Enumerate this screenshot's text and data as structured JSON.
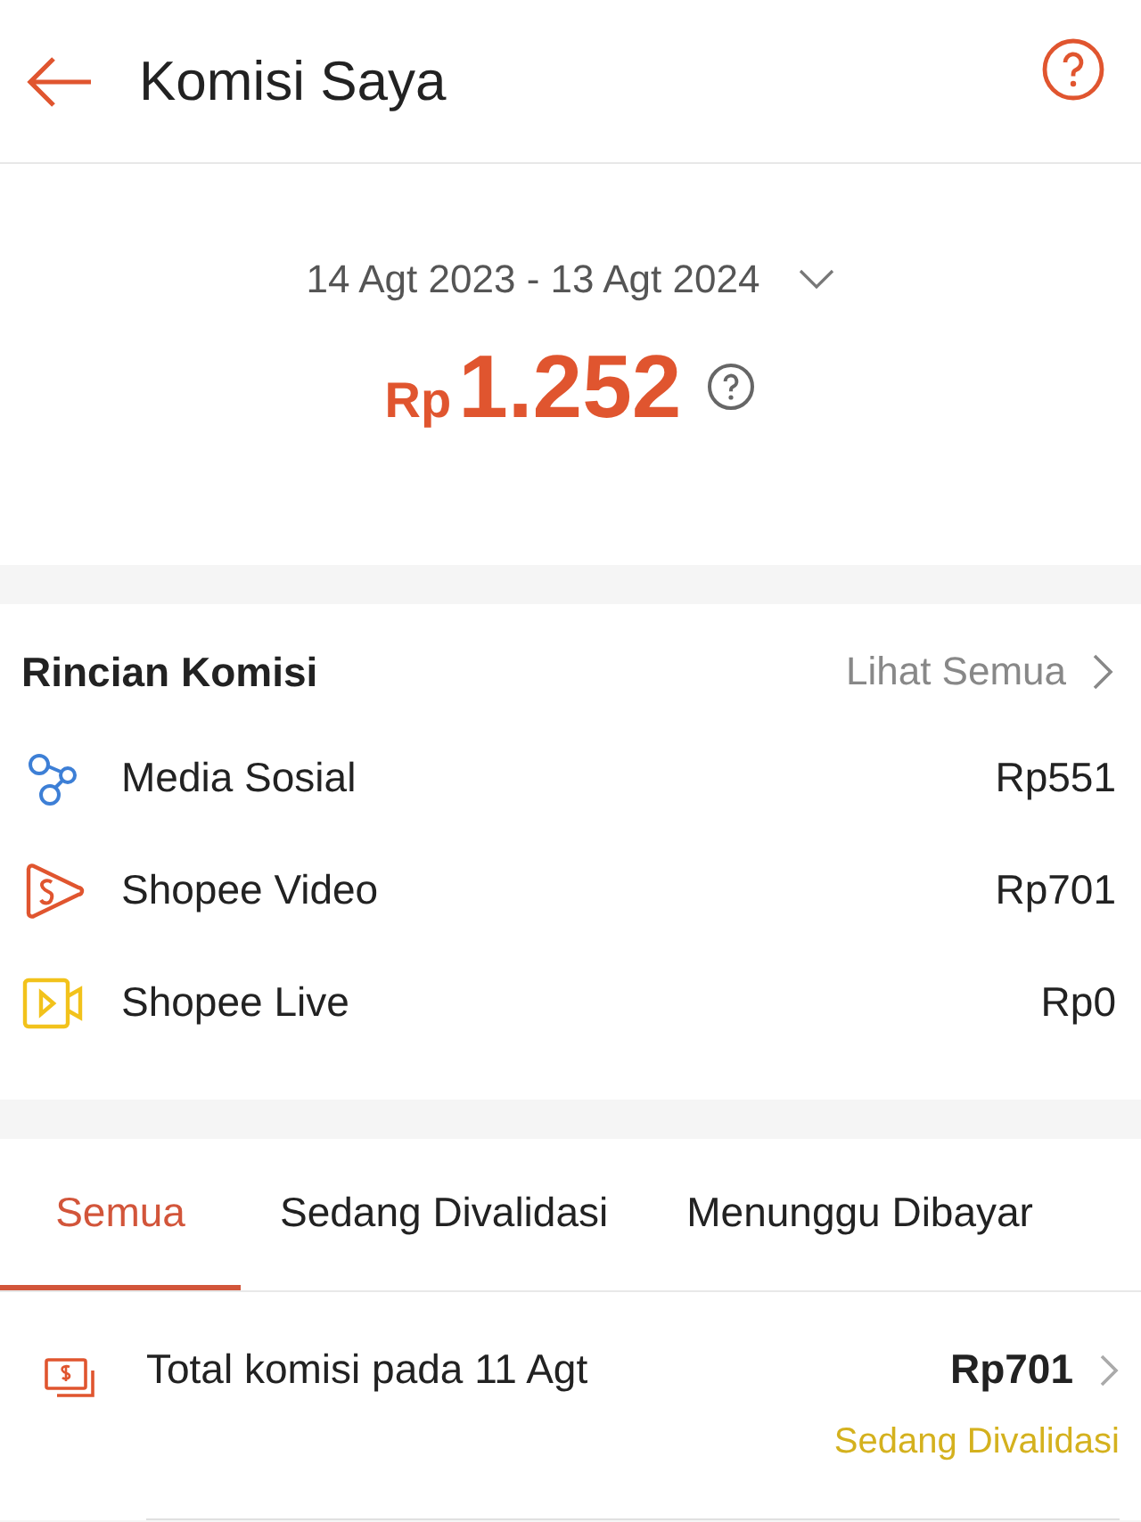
{
  "header": {
    "title": "Komisi Saya"
  },
  "summary": {
    "period": "14 Agt 2023 - 13 Agt 2024",
    "currency": "Rp",
    "amount": "1.252"
  },
  "breakdown": {
    "title": "Rincian Komisi",
    "link": "Lihat Semua",
    "items": [
      {
        "kind": "social",
        "label": "Media Sosial",
        "value": "Rp551"
      },
      {
        "kind": "video",
        "label": "Shopee Video",
        "value": "Rp701"
      },
      {
        "kind": "live",
        "label": "Shopee Live",
        "value": "Rp0"
      }
    ]
  },
  "tabs": [
    {
      "label": "Semua",
      "selected": true
    },
    {
      "label": "Sedang Divalidasi",
      "selected": false
    },
    {
      "label": "Menunggu Dibayar",
      "selected": false
    }
  ],
  "entries": [
    {
      "label": "Total komisi pada 11 Agt",
      "amount": "Rp701",
      "status": "Sedang Divalidasi"
    }
  ]
}
